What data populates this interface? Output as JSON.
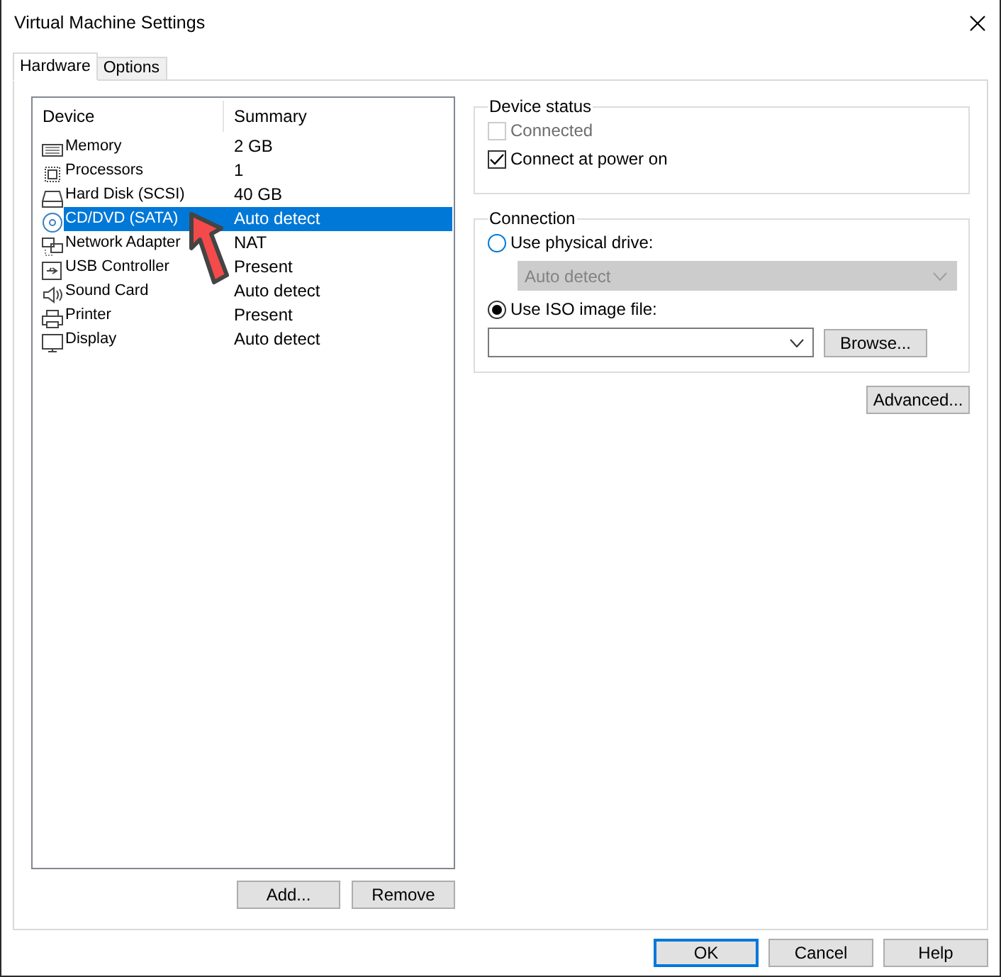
{
  "window": {
    "title": "Virtual Machine Settings"
  },
  "tabs": [
    {
      "label": "Hardware",
      "selected": true
    },
    {
      "label": "Options",
      "selected": false
    }
  ],
  "device_list": {
    "columns": [
      "Device",
      "Summary"
    ],
    "rows": [
      {
        "kind": "memory",
        "device": "Memory",
        "summary": "2 GB",
        "selected": false
      },
      {
        "kind": "processor",
        "device": "Processors",
        "summary": "1",
        "selected": false
      },
      {
        "kind": "disk",
        "device": "Hard Disk (SCSI)",
        "summary": "40 GB",
        "selected": false
      },
      {
        "kind": "cdrom",
        "device": "CD/DVD (SATA)",
        "summary": "Auto detect",
        "selected": true
      },
      {
        "kind": "network",
        "device": "Network Adapter",
        "summary": "NAT",
        "selected": false
      },
      {
        "kind": "usb",
        "device": "USB Controller",
        "summary": "Present",
        "selected": false
      },
      {
        "kind": "sound",
        "device": "Sound Card",
        "summary": "Auto detect",
        "selected": false
      },
      {
        "kind": "printer",
        "device": "Printer",
        "summary": "Present",
        "selected": false
      },
      {
        "kind": "display",
        "device": "Display",
        "summary": "Auto detect",
        "selected": false
      }
    ]
  },
  "list_buttons": [
    "Add...",
    "Remove"
  ],
  "device_status": {
    "title": "Device status",
    "options": [
      {
        "label": "Connected",
        "checked": false,
        "disabled": true
      },
      {
        "label": "Connect at power on",
        "checked": true,
        "disabled": false
      }
    ]
  },
  "connection": {
    "title": "Connection",
    "physical_drive": {
      "label": "Use physical drive:",
      "selected": false,
      "dropdown": {
        "value": "Auto detect",
        "disabled": true
      }
    },
    "iso_image": {
      "label": "Use ISO image file:",
      "selected": true,
      "browse_button": "Browse..."
    }
  },
  "advanced_button": "Advanced...",
  "dialog_buttons": [
    {
      "label": "OK",
      "default": true
    },
    {
      "label": "Cancel",
      "default": false
    },
    {
      "label": "Help",
      "default": false
    }
  ]
}
